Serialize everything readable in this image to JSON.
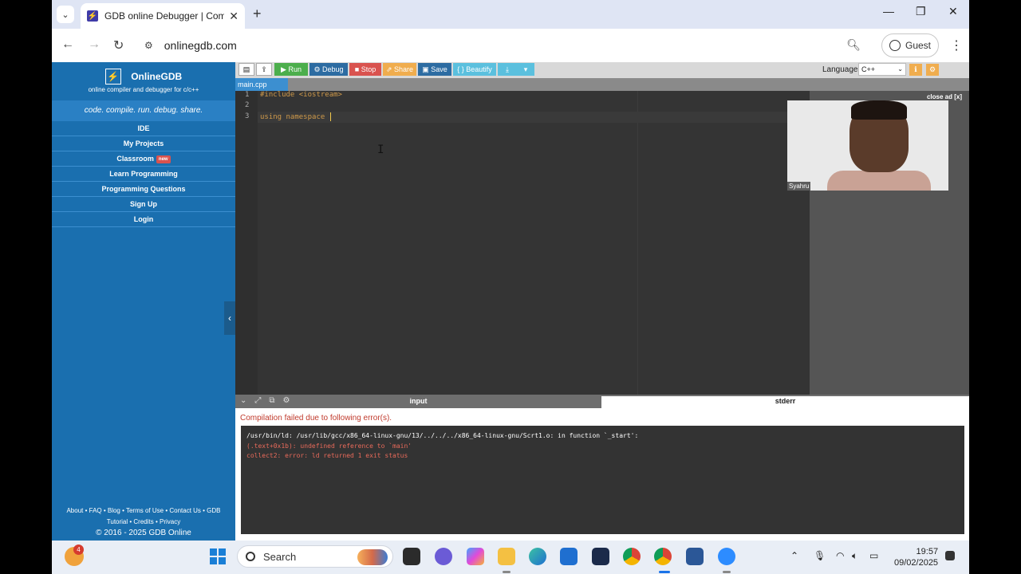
{
  "browser": {
    "tab_title": "GDB online Debugger | Compiler - Code, Compile, Run, Debug online C, C++",
    "url": "onlinegdb.com",
    "profile_label": "Guest"
  },
  "sidebar": {
    "brand_name": "OnlineGDB",
    "brand_sub": "online compiler and debugger for c/c++",
    "tagline": "code. compile. run. debug. share.",
    "menu": [
      {
        "label": "IDE"
      },
      {
        "label": "My Projects"
      },
      {
        "label": "Classroom",
        "badge": "new"
      },
      {
        "label": "Learn Programming"
      },
      {
        "label": "Programming Questions"
      },
      {
        "label": "Sign Up"
      },
      {
        "label": "Login"
      }
    ],
    "footer_line1": "About • FAQ • Blog • Terms of Use • Contact Us • GDB",
    "footer_line2": "Tutorial • Credits • Privacy",
    "copyright": "© 2016 - 2025 GDB Online"
  },
  "toolbar": {
    "run": "Run",
    "debug": "Debug",
    "stop": "Stop",
    "share": "Share",
    "save": "Save",
    "beautify": "{ } Beautify",
    "language_label": "Language",
    "language_value": "C++"
  },
  "editor": {
    "file_tab": "main.cpp",
    "lines": [
      {
        "num": "1",
        "text": "#include <iostream>"
      },
      {
        "num": "2",
        "text": ""
      },
      {
        "num": "3",
        "text": "using namespace "
      }
    ]
  },
  "ad": {
    "close_label": "close ad [x]",
    "video_name": "Syahru"
  },
  "panel": {
    "input_tab": "input",
    "stderr_tab": "stderr",
    "compile_message": "Compilation failed due to following error(s).",
    "console_lines": [
      {
        "text": "/usr/bin/ld: /usr/lib/gcc/x86_64-linux-gnu/13/../../../x86_64-linux-gnu/Scrt1.o: in function `_start':",
        "color": "#ffffff"
      },
      {
        "text": "(.text+0x1b): undefined reference to `main'",
        "color": "#e86a5a"
      },
      {
        "text": "collect2: error: ld returned 1 exit status",
        "color": "#e86a5a"
      }
    ]
  },
  "taskbar": {
    "weather_badge": "4",
    "search_placeholder": "Search",
    "time": "19:57",
    "date": "09/02/2025"
  }
}
